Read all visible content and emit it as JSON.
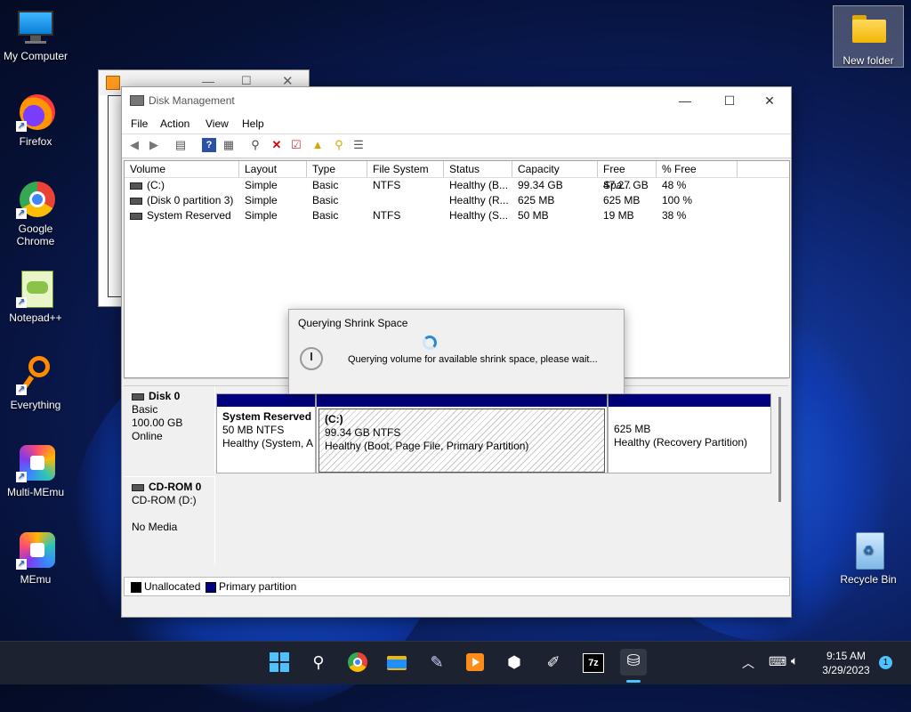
{
  "desktop_icons": [
    {
      "label": "My Computer"
    },
    {
      "label": "Firefox"
    },
    {
      "label": "Google Chrome"
    },
    {
      "label": "Notepad++"
    },
    {
      "label": "Everything"
    },
    {
      "label": "Multi-MEmu"
    },
    {
      "label": "MEmu"
    }
  ],
  "new_folder": {
    "label": "New folder"
  },
  "recycle_bin": {
    "label": "Recycle Bin"
  },
  "window": {
    "title": "Disk Management",
    "menu": [
      "File",
      "Action",
      "View",
      "Help"
    ]
  },
  "volumes": {
    "columns": [
      "Volume",
      "Layout",
      "Type",
      "File System",
      "Status",
      "Capacity",
      "Free Spa...",
      "% Free"
    ],
    "rows": [
      {
        "volume": "(C:)",
        "layout": "Simple",
        "type": "Basic",
        "fs": "NTFS",
        "status": "Healthy (B...",
        "capacity": "99.34 GB",
        "free": "47.27 GB",
        "pct": "48 %"
      },
      {
        "volume": "(Disk 0 partition 3)",
        "layout": "Simple",
        "type": "Basic",
        "fs": "",
        "status": "Healthy (R...",
        "capacity": "625 MB",
        "free": "625 MB",
        "pct": "100 %"
      },
      {
        "volume": "System Reserved",
        "layout": "Simple",
        "type": "Basic",
        "fs": "NTFS",
        "status": "Healthy (S...",
        "capacity": "50 MB",
        "free": "19 MB",
        "pct": "38 %"
      }
    ]
  },
  "disk0": {
    "name": "Disk 0",
    "type": "Basic",
    "size": "100.00 GB",
    "state": "Online",
    "partitions": [
      {
        "name": "System Reserved",
        "size": "50 MB NTFS",
        "status": "Healthy (System, A"
      },
      {
        "name": "(C:)",
        "size": "99.34 GB NTFS",
        "status": "Healthy (Boot, Page File, Primary Partition)"
      },
      {
        "name": "",
        "size": "625 MB",
        "status": "Healthy (Recovery Partition)"
      }
    ]
  },
  "cdrom": {
    "name": "CD-ROM 0",
    "drive": "CD-ROM (D:)",
    "media": "No Media"
  },
  "legend": {
    "unallocated": "Unallocated",
    "primary": "Primary partition"
  },
  "dialog": {
    "title": "Querying Shrink Space",
    "message": "Querying volume for available shrink space, please wait..."
  },
  "clock": {
    "time": "9:15 AM",
    "date": "3/29/2023",
    "notifications": "1"
  }
}
